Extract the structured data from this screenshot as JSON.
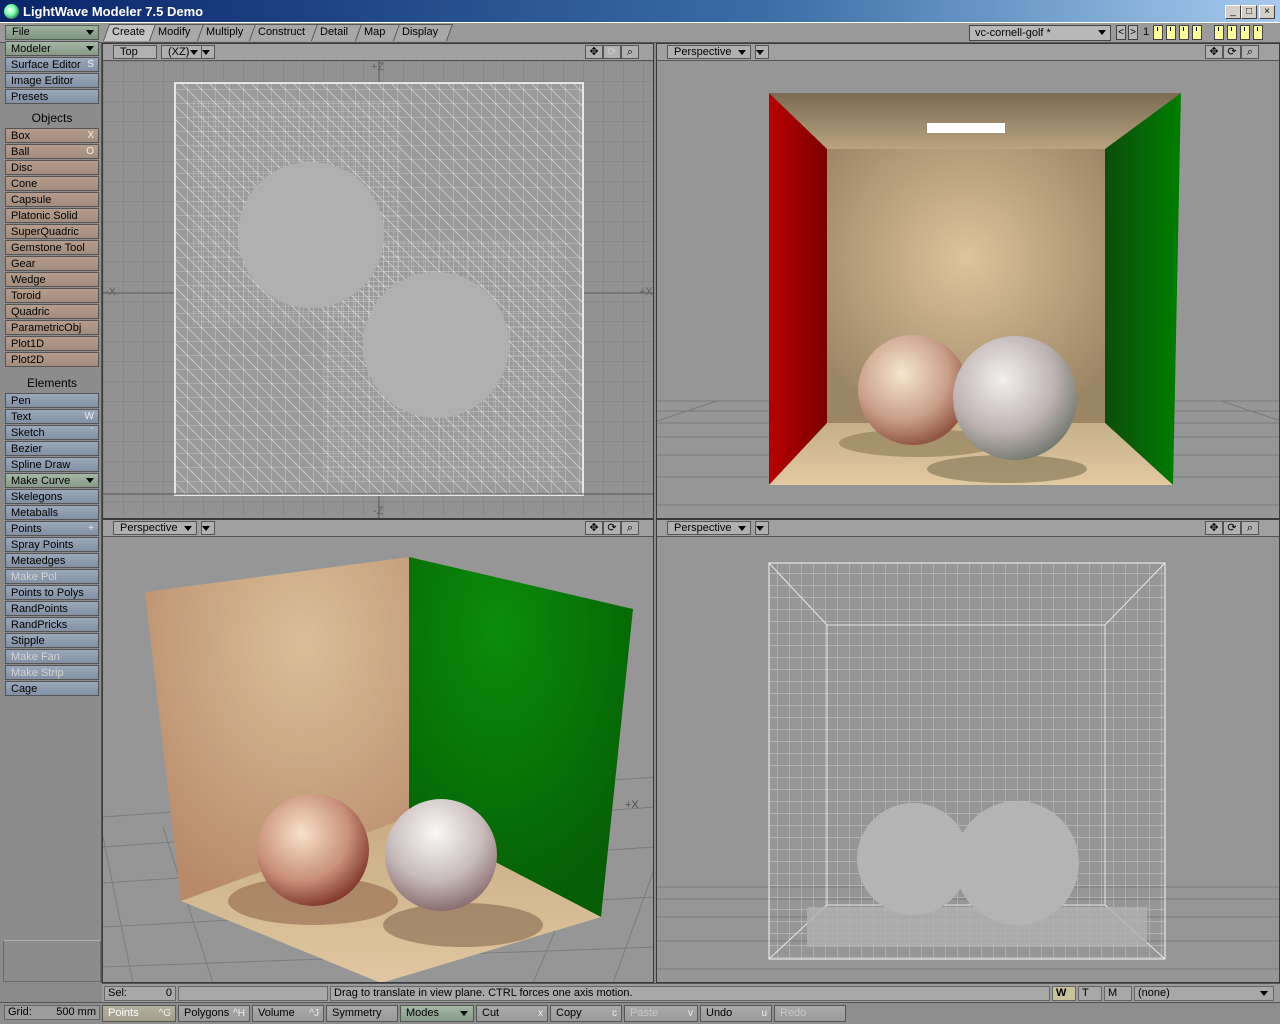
{
  "window": {
    "title": "LightWave Modeler 7.5 Demo",
    "minimize": "_",
    "maximize": "□",
    "close": "×"
  },
  "menus": {
    "file": "File",
    "modeler": "Modeler"
  },
  "tabs": [
    "Create",
    "Modify",
    "Multiply",
    "Construct",
    "Detail",
    "Map",
    "Display"
  ],
  "object_select": {
    "value": "vc-cornell-golf *"
  },
  "layer_nav": {
    "prev": "<",
    "next": ">",
    "number": "1"
  },
  "sidebar": {
    "top_items": [
      {
        "label": "Surface Editor",
        "shortcut": "S"
      },
      {
        "label": "Image Editor",
        "shortcut": ""
      },
      {
        "label": "Presets",
        "shortcut": ""
      }
    ],
    "objects_header": "Objects",
    "objects": [
      {
        "label": "Box",
        "shortcut": "X",
        "disabled": false
      },
      {
        "label": "Ball",
        "shortcut": "O",
        "disabled": false
      },
      {
        "label": "Disc",
        "shortcut": "",
        "disabled": false
      },
      {
        "label": "Cone",
        "shortcut": "",
        "disabled": false
      },
      {
        "label": "Capsule",
        "shortcut": "",
        "disabled": false
      },
      {
        "label": "Platonic Solid",
        "shortcut": "",
        "disabled": false
      },
      {
        "label": "SuperQuadric",
        "shortcut": "",
        "disabled": false
      },
      {
        "label": "Gemstone Tool",
        "shortcut": "",
        "disabled": false
      },
      {
        "label": "Gear",
        "shortcut": "",
        "disabled": false
      },
      {
        "label": "Wedge",
        "shortcut": "",
        "disabled": false
      },
      {
        "label": "Toroid",
        "shortcut": "",
        "disabled": false
      },
      {
        "label": "Quadric",
        "shortcut": "",
        "disabled": false
      },
      {
        "label": "ParametricObj",
        "shortcut": "",
        "disabled": false
      },
      {
        "label": "Plot1D",
        "shortcut": "",
        "disabled": false
      },
      {
        "label": "Plot2D",
        "shortcut": "",
        "disabled": false
      }
    ],
    "elements_header": "Elements",
    "elements": [
      {
        "label": "Pen",
        "shortcut": "",
        "disabled": false
      },
      {
        "label": "Text",
        "shortcut": "W",
        "disabled": false
      },
      {
        "label": "Sketch",
        "shortcut": "`",
        "disabled": false
      },
      {
        "label": "Bezier",
        "shortcut": "",
        "disabled": false
      },
      {
        "label": "Spline Draw",
        "shortcut": "",
        "disabled": false
      },
      {
        "label": "Make Curve",
        "shortcut": "",
        "disabled": false,
        "dropdown": true
      },
      {
        "label": "Skelegons",
        "shortcut": "",
        "disabled": false
      },
      {
        "label": "Metaballs",
        "shortcut": "",
        "disabled": false
      },
      {
        "label": "Points",
        "shortcut": "+",
        "disabled": false
      },
      {
        "label": "Spray Points",
        "shortcut": "",
        "disabled": false
      },
      {
        "label": "Metaedges",
        "shortcut": "",
        "disabled": false
      },
      {
        "label": "Make Pol",
        "shortcut": "",
        "disabled": true
      },
      {
        "label": "Points to Polys",
        "shortcut": "",
        "disabled": false
      },
      {
        "label": "RandPoints",
        "shortcut": "",
        "disabled": false
      },
      {
        "label": "RandPricks",
        "shortcut": "",
        "disabled": false
      },
      {
        "label": "Stipple",
        "shortcut": "",
        "disabled": false
      },
      {
        "label": "Make Fan",
        "shortcut": "",
        "disabled": true
      },
      {
        "label": "Make Strip",
        "shortcut": "",
        "disabled": true
      },
      {
        "label": "Cage",
        "shortcut": "",
        "disabled": false
      }
    ]
  },
  "viewports": {
    "top_left": {
      "view": "Top",
      "axes": "(XZ)",
      "label_top": "+Z",
      "label_bottom": "-Z",
      "label_left": "-X",
      "label_right": "+X"
    },
    "top_right": {
      "view": "Perspective"
    },
    "bottom_left": {
      "view": "Perspective",
      "axis_label": "+X"
    },
    "bottom_right": {
      "view": "Perspective"
    }
  },
  "status": {
    "sel_label": "Sel:",
    "sel_value": "0",
    "message": "Drag to translate in view plane. CTRL forces one axis motion.",
    "w": "W",
    "t": "T",
    "m": "M",
    "surface": "(none)"
  },
  "bottom": {
    "grid_label": "Grid:",
    "grid_value": "500 mm",
    "buttons": [
      {
        "label": "Points",
        "shortcut": "^G"
      },
      {
        "label": "Polygons",
        "shortcut": "^H"
      },
      {
        "label": "Volume",
        "shortcut": "^J"
      },
      {
        "label": "Symmetry",
        "shortcut": ""
      },
      {
        "label": "Modes",
        "shortcut": ""
      },
      {
        "label": "Cut",
        "shortcut": "x"
      },
      {
        "label": "Copy",
        "shortcut": "c"
      },
      {
        "label": "Paste",
        "shortcut": "v"
      },
      {
        "label": "Undo",
        "shortcut": "u"
      },
      {
        "label": "Redo",
        "shortcut": ""
      }
    ]
  },
  "colors": {
    "red_wall": "#b00000",
    "green_wall": "#007a00",
    "back_wall": "#d8c09a",
    "wire": "#e6e6e6",
    "ball_fill": "#b4b4b4"
  }
}
